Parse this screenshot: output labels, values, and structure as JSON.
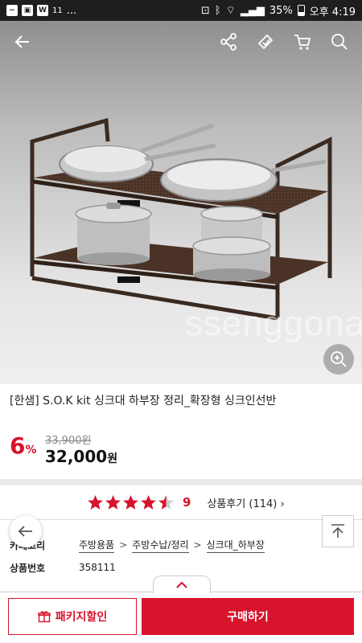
{
  "status_bar": {
    "notification_badge": "11",
    "ellipsis": "...",
    "battery": "35%",
    "time": "오후 4:19",
    "app_icon_letter": "W"
  },
  "hero": {
    "watermark": "ssenggonaria"
  },
  "product": {
    "title": "[한샘] S.O.K kit 싱크대 하부장 정리_확장형 싱크인선반",
    "discount_num": "6",
    "discount_pct": "%",
    "original_price": "33,900원",
    "sale_price": "32,000",
    "sale_unit": "원"
  },
  "rating": {
    "stars": 4.5,
    "score": "9",
    "review_label": "상품후기 (114)",
    "star_color": "#d7142c"
  },
  "info": {
    "category_label": "카테고리",
    "category": [
      "주방용품",
      "주방수납/정리",
      "싱크대_하부장"
    ],
    "separator": ">",
    "product_no_label": "상품번호",
    "product_no": "358111"
  },
  "bottom": {
    "package_label": "패키지할인",
    "buy_label": "구매하기"
  },
  "colors": {
    "accent": "#d7142c"
  }
}
